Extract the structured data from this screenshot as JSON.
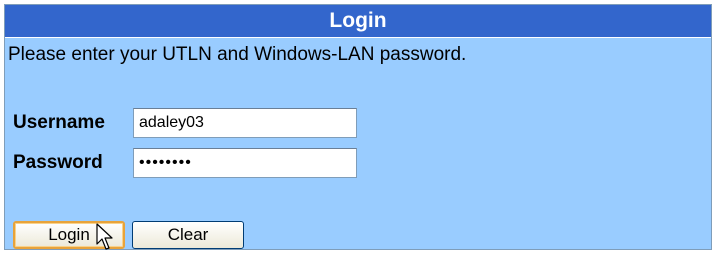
{
  "panel": {
    "title": "Login",
    "instructions": "Please enter your UTLN and Windows-LAN password."
  },
  "form": {
    "username_label": "Username",
    "username_value": "adaley03",
    "password_label": "Password",
    "password_value": "••••••••"
  },
  "actions": {
    "login_label": "Login",
    "clear_label": "Clear"
  },
  "colors": {
    "title_bar": "#3366cc",
    "panel_background": "#99ccff",
    "default_button_border": "#e8a33a"
  },
  "icons": {
    "pointer": "mouse-pointer-icon"
  }
}
